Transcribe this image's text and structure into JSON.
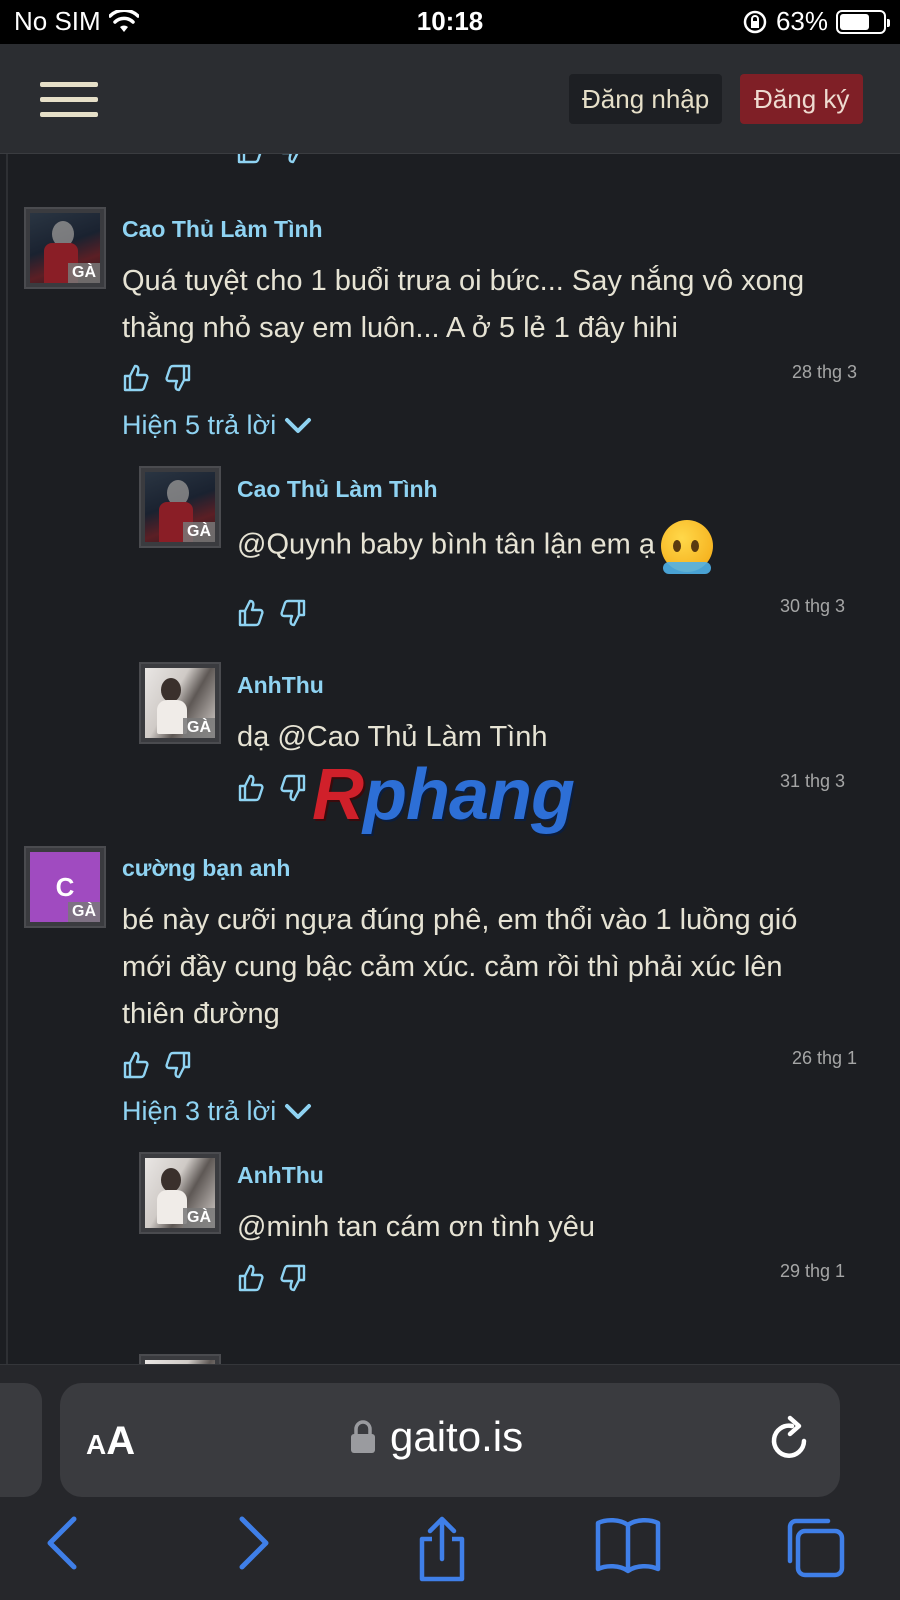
{
  "status_bar": {
    "carrier": "No SIM",
    "time": "10:18",
    "battery_pct": "63%",
    "battery_level": 0.63
  },
  "nav": {
    "login": "Đăng nhập",
    "register": "Đăng ký"
  },
  "comments": [
    {
      "user": "Cao Thủ Làm Tình",
      "badge": "GÀ",
      "text": "Quá tuyệt cho 1 buổi trưa oi bức... Say nắng vô xong thằng nhỏ say em luôn... A ở 5 lẻ 1 đây hihi",
      "date": "28 thg 3",
      "replies_label": "Hiện 5 trả lời",
      "replies": [
        {
          "user": "Cao Thủ Làm Tình",
          "badge": "GÀ",
          "text": "@Quynh baby bình tân lận em ạ",
          "date": "30 thg 3"
        },
        {
          "user": "AnhThu",
          "badge": "GÀ",
          "text": "dạ @Cao Thủ Làm Tình",
          "date": "31 thg 3"
        }
      ]
    },
    {
      "user": "cường bạn anh",
      "badge": "GÀ",
      "avatar_letter": "C",
      "text": "bé này cưỡi ngựa đúng phê, em thổi vào 1 luồng gió mới đầy cung bậc cảm xúc. cảm rồi thì phải xúc lên thiên đường",
      "date": "26 thg 1",
      "replies_label": "Hiện 3 trả lời",
      "replies": [
        {
          "user": "AnhThu",
          "badge": "GÀ",
          "text": "@minh tan cám ơn tình yêu",
          "date": "29 thg 1"
        }
      ]
    }
  ],
  "watermark": {
    "first": "R",
    "rest": "phang"
  },
  "browser": {
    "aa_small": "A",
    "aa_large": "A",
    "url": "gaito.is"
  },
  "colors": {
    "background": "#1c1e22",
    "username": "#8fd3f2",
    "register": "#7f1f26"
  },
  "icons": [
    "wifi-icon",
    "lock-rotation-icon",
    "hamburger-icon",
    "thumbs-up-icon",
    "thumbs-down-icon",
    "chevron-down-icon",
    "lock-icon",
    "reload-icon",
    "back-icon",
    "forward-icon",
    "share-icon",
    "bookmarks-icon",
    "tabs-icon"
  ]
}
